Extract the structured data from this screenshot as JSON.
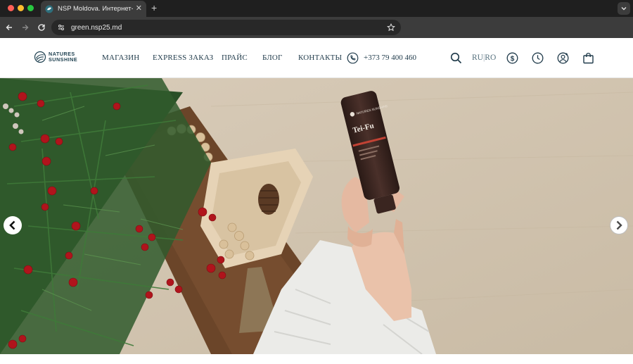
{
  "browser": {
    "tab_title": "NSP Moldova. Интернет-маг",
    "url": "green.nsp25.md",
    "icons": [
      "back-arrow-icon",
      "forward-arrow-icon",
      "reload-icon",
      "tune-icon",
      "bookmark-star-icon",
      "new-tab-plus-icon",
      "close-icon",
      "chevron-down-icon"
    ]
  },
  "site": {
    "logo": {
      "line1": "NATURES",
      "line2": "SUNSHINE"
    },
    "nav": [
      "МАГАЗИН",
      "EXPRESS ЗАКАЗ",
      "ПРАЙС",
      "БЛОГ",
      "КОНТАКТЫ"
    ],
    "phone": "+373 79 400 460",
    "lang": {
      "ru": "RU",
      "divider": "|",
      "ro": "RO"
    },
    "icons": [
      "phone-icon",
      "search-icon",
      "currency-icon",
      "clock-icon",
      "user-icon",
      "shopping-bag-icon"
    ]
  },
  "hero": {
    "product_label": "Tei-Fu",
    "product_brand": "NATURES SUNSHINE",
    "colors": {
      "wall": "#d3c6b3",
      "pine": "#2f5a2c",
      "berry": "#b0141c",
      "tube": "#3b2621",
      "sweater": "#ebebe8"
    },
    "controls": [
      "arrow-left-icon",
      "arrow-right-icon"
    ]
  }
}
